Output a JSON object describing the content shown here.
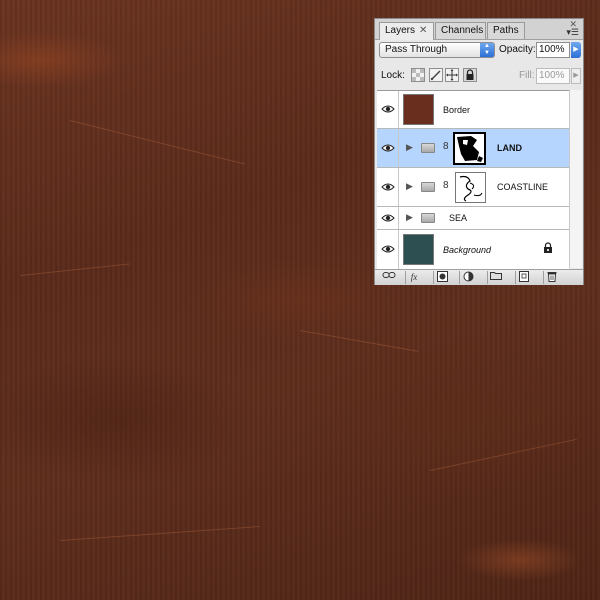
{
  "canvas": {
    "description_colors": {
      "base": "#5a2c1c"
    }
  },
  "panel": {
    "tabs": [
      {
        "label": "Layers",
        "active": true
      },
      {
        "label": "Channels",
        "active": false
      },
      {
        "label": "Paths",
        "active": false
      }
    ],
    "tab_close": "✕",
    "panel_close": "✕",
    "panel_menu": "▾☰",
    "blend_mode": "Pass Through",
    "opacity_label": "Opacity:",
    "opacity_value": "100%",
    "lock_label": "Lock:",
    "fill_label": "Fill:",
    "fill_value": "100%",
    "layers": [
      {
        "name": "Border",
        "selected": false,
        "visible": true,
        "type": "layer",
        "thumb": "#6a2e1e"
      },
      {
        "name": "LAND",
        "selected": true,
        "visible": true,
        "type": "group-masked"
      },
      {
        "name": "COASTLINE",
        "selected": false,
        "visible": true,
        "type": "group-masked"
      },
      {
        "name": "SEA",
        "selected": false,
        "visible": true,
        "type": "group"
      },
      {
        "name": "Background",
        "selected": false,
        "visible": true,
        "type": "background",
        "thumb": "#2d4f52",
        "locked": true
      }
    ],
    "bottom_icons": [
      "link-layers-icon",
      "fx-icon",
      "add-mask-icon",
      "adjustment-layer-icon",
      "new-group-icon",
      "new-layer-icon",
      "trash-icon"
    ],
    "fx_text": "fx"
  }
}
